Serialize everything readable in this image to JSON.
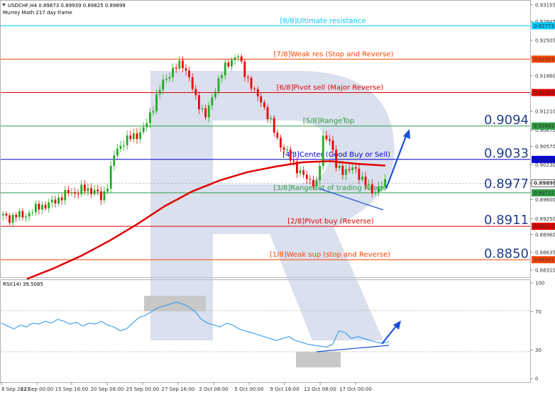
{
  "header": {
    "symbol_line": "USDCHF,H4  0.89873 0.89939 0.89825 0.89899",
    "indicator_line": "Murrey Math 217 day frame"
  },
  "rsi_label": "RSI(14) 39.5085",
  "chart_data": [
    {
      "type": "candlestick",
      "symbol": "USDCHF",
      "timeframe": "H4",
      "ohlc_last": {
        "open": 0.89873,
        "high": 0.89939,
        "low": 0.89825,
        "close": 0.89899
      },
      "ylim": [
        0.8818,
        0.9323
      ],
      "y_ticks": [
        "0.93155",
        "0.92845",
        "0.92505",
        "0.92195",
        "0.91860",
        "0.91525",
        "0.91210",
        "0.90870",
        "0.90570",
        "0.90230",
        "0.89899",
        "0.89600",
        "0.89250",
        "0.88960",
        "0.88635",
        "0.88310"
      ],
      "x_ticks": [
        "8 Sep 2023",
        "13 Sep 00:00",
        "15 Sep 16:00",
        "20 Sep 08:00",
        "25 Sep 00:00",
        "27 Sep 16:00",
        "2 Oct 08:00",
        "5 Oct 00:00",
        "9 Oct 16:00",
        "12 Oct 08:00",
        "17 Oct 00:00"
      ],
      "current_price": 0.89899,
      "close_path": [
        0.893,
        0.8925,
        0.8932,
        0.8929,
        0.8934,
        0.894,
        0.895,
        0.8948,
        0.8955,
        0.8962,
        0.8968,
        0.8975,
        0.8972,
        0.898,
        0.8978,
        0.8975,
        0.896,
        0.899,
        0.904,
        0.906,
        0.9068,
        0.9075,
        0.908,
        0.909,
        0.912,
        0.915,
        0.9175,
        0.919,
        0.92,
        0.921,
        0.919,
        0.915,
        0.913,
        0.911,
        0.915,
        0.918,
        0.92,
        0.9215,
        0.9225,
        0.9195,
        0.9175,
        0.915,
        0.914,
        0.911,
        0.9085,
        0.906,
        0.9045,
        0.903,
        0.901,
        0.9,
        0.8995,
        0.8985,
        0.908,
        0.907,
        0.902,
        0.9015,
        0.901,
        0.902,
        0.9,
        0.8985,
        0.8975,
        0.898,
        0.899
      ],
      "murrey_levels": [
        {
          "label": "[8/8]Ultimate resistance",
          "value": "0.92773",
          "color": "#00c8ff"
        },
        {
          "label": "[7/8]Weak res (Stop and Reverse)",
          "value": "0.92163",
          "color": "#ff4500"
        },
        {
          "label": "[6/8]Pivot sell (Major Reverse)",
          "value": "0.91553",
          "color": "#e00000"
        },
        {
          "label": "[5/8]RangeTop",
          "value": "0.90942",
          "color": "#2e9e44"
        },
        {
          "label": "[4/8]Center (Good Buy or Sell)",
          "value": "0.90332",
          "color": "#0000dd"
        },
        {
          "label": "[3/8]RangeBot of trading Range",
          "value": "0.89722",
          "color": "#2e9e44"
        },
        {
          "label": "[2/8]Pivot buy (Reverse)",
          "value": "0.89111",
          "color": "#e00000"
        },
        {
          "label": "[1/8]Weak sup (stop and Reverse)",
          "value": "0.88501",
          "color": "#ff4500"
        }
      ],
      "key_levels": [
        "0.9094",
        "0.9033",
        "0.8977",
        "0.8911",
        "0.8850"
      ],
      "moving_average": {
        "color": "#e00000",
        "values": [
          0.8815,
          0.8835,
          0.8858,
          0.8885,
          0.8915,
          0.8948,
          0.8975,
          0.8995,
          0.901,
          0.902,
          0.9028,
          0.903,
          0.9025,
          0.9022
        ]
      },
      "colors": {
        "bull": "#22aa22",
        "bear": "#ee0000",
        "annotation": "#1a4fd6",
        "watermark": "#bcc6de"
      }
    },
    {
      "type": "line",
      "name": "RSI(14)",
      "value_text": "39.5085",
      "ylim": [
        0,
        100
      ],
      "y_ticks": [
        "100",
        "70",
        "30",
        "0"
      ],
      "values": [
        58,
        55,
        52,
        56,
        54,
        58,
        57,
        60,
        58,
        62,
        60,
        57,
        59,
        55,
        58,
        57,
        60,
        56,
        54,
        50,
        52,
        58,
        64,
        66,
        70,
        74,
        76,
        78,
        80,
        78,
        75,
        70,
        62,
        58,
        56,
        54,
        58,
        56,
        52,
        50,
        48,
        46,
        44,
        42,
        40,
        42,
        44,
        40,
        38,
        36,
        35,
        34,
        33,
        36,
        50,
        48,
        42,
        44,
        42,
        40,
        38,
        37,
        39
      ]
    }
  ]
}
